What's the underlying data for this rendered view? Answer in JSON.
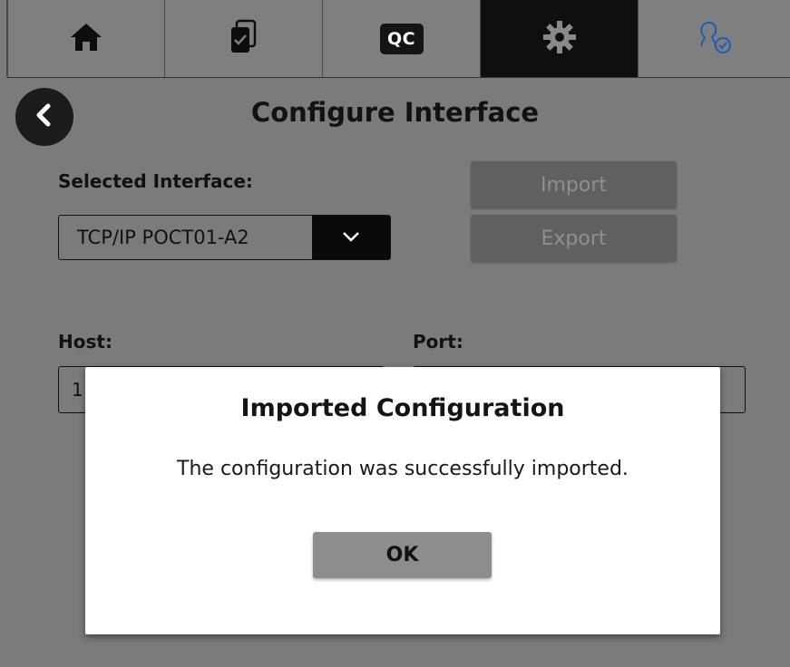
{
  "nav": {
    "tabs": [
      {
        "icon": "home-icon",
        "active": false
      },
      {
        "icon": "clipboard-check-icon",
        "active": false
      },
      {
        "icon": "qc-icon",
        "label": "QC",
        "active": false
      },
      {
        "icon": "gear-icon",
        "active": true
      },
      {
        "icon": "user-check-icon",
        "active": false
      }
    ]
  },
  "page": {
    "title": "Configure Interface",
    "back_icon": "chevron-left-icon"
  },
  "interface": {
    "selected_label": "Selected Interface:",
    "selected_value": "TCP/IP POCT01-A2",
    "dropdown_icon": "chevron-down-icon",
    "import_label": "Import",
    "export_label": "Export"
  },
  "connection": {
    "host_label": "Host:",
    "host_value": "1",
    "port_label": "Port:",
    "port_value": ""
  },
  "dialog": {
    "title": "Imported Configuration",
    "message": "The configuration was successfully imported.",
    "ok_label": "OK"
  },
  "colors": {
    "background": "#7b7b7b",
    "active_tab": "#0f0f0f",
    "disabled_button": "#606060",
    "dialog_ok": "#8d8d8d"
  }
}
